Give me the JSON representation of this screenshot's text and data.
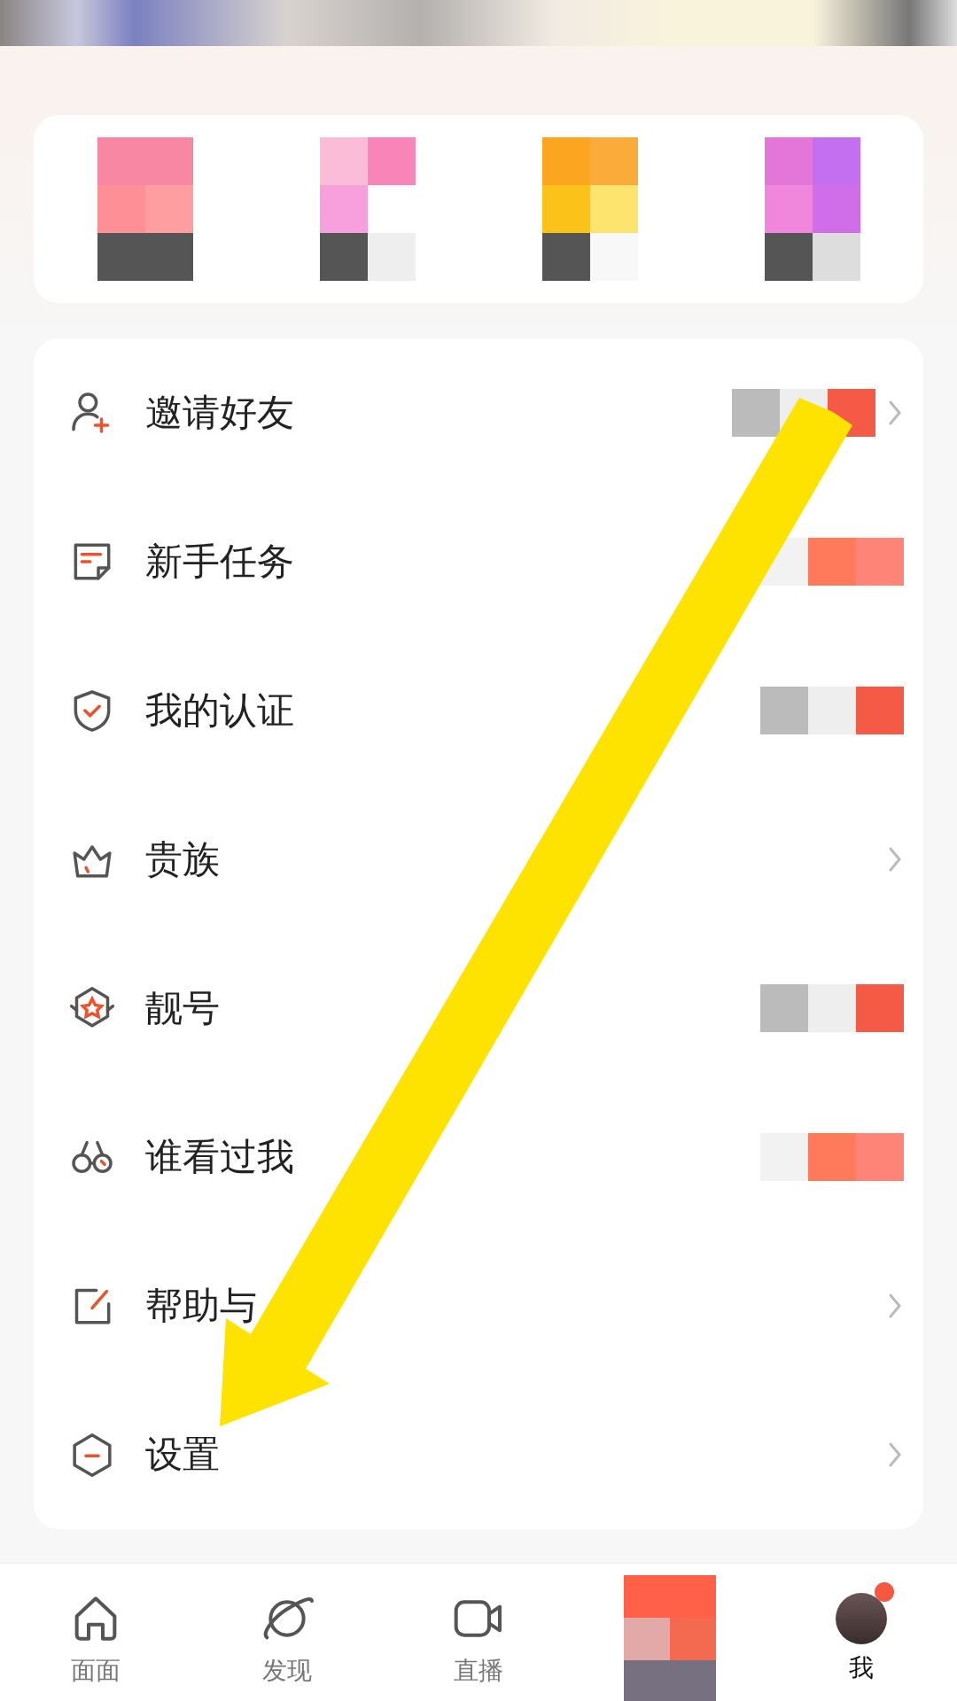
{
  "shortcuts": [
    {
      "kind": "pixelated"
    },
    {
      "kind": "pixelated"
    },
    {
      "kind": "pixelated"
    },
    {
      "kind": "pixelated"
    }
  ],
  "menu": [
    {
      "label": "邀请好友",
      "obscured": true,
      "chevron": true
    },
    {
      "label": "新手任务",
      "obscured": true,
      "chevron": false
    },
    {
      "label": "我的认证",
      "obscured": true,
      "chevron": false
    },
    {
      "label": "贵族",
      "obscured": false,
      "chevron": true
    },
    {
      "label": "靓号",
      "obscured": true,
      "chevron": false
    },
    {
      "label": "谁看过我",
      "obscured": true,
      "chevron": false
    },
    {
      "label": "帮助与",
      "obscured": false,
      "chevron": true
    },
    {
      "label": "设置",
      "obscured": false,
      "chevron": true
    }
  ],
  "tab_bar": [
    {
      "kind": "icon",
      "label": "面面",
      "selected": false
    },
    {
      "kind": "icon",
      "label": "发现",
      "selected": false
    },
    {
      "kind": "icon",
      "label": "直播",
      "selected": false
    },
    {
      "kind": "pixelated",
      "selected": false
    },
    {
      "kind": "avatar",
      "label": "我",
      "selected": true,
      "dot": true
    }
  ]
}
